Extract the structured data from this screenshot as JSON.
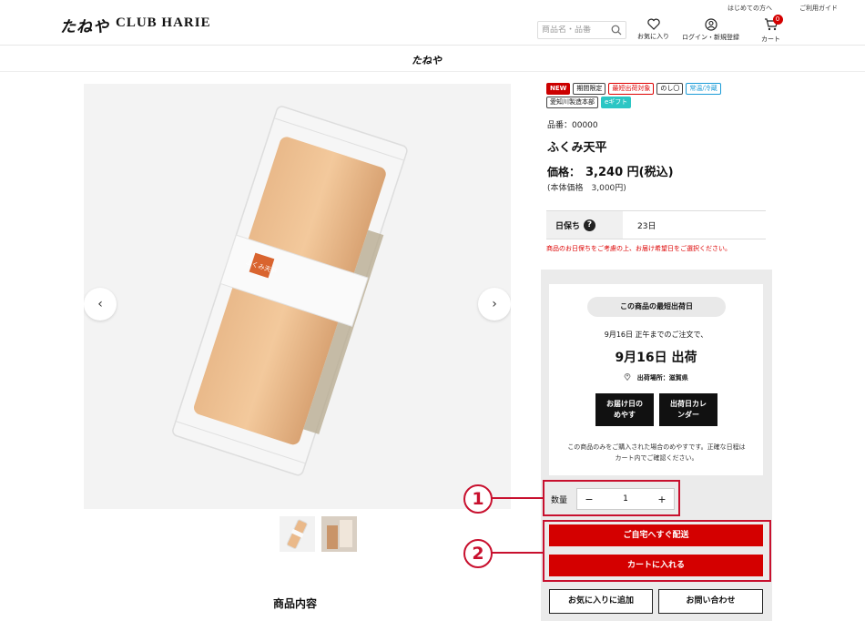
{
  "header": {
    "logo_main": "たねや",
    "logo_club": "CLUB HARIE",
    "links": [
      "はじめての方へ",
      "ご利用ガイド"
    ],
    "search_placeholder": "商品名・品番",
    "favorites_label": "お気に入り",
    "login_label": "ログイン・新規登録",
    "cart_label": "カート",
    "cart_count": "0",
    "sub_logo": "たねや"
  },
  "product": {
    "badges": [
      {
        "text": "NEW",
        "style": "new"
      },
      {
        "text": "期間限定",
        "style": "plain"
      },
      {
        "text": "最短出荷対象",
        "style": "red"
      },
      {
        "text": "のし〇",
        "style": "plain"
      },
      {
        "text": "常温/冷蔵",
        "style": "blue"
      },
      {
        "text": "愛知川製造本部",
        "style": "plain"
      },
      {
        "text": "eギフト",
        "style": "teal"
      }
    ],
    "sku": "品番：00000",
    "name": "ふくみ天平",
    "price_label": "価格：",
    "price_value": "3,240 円(税込)",
    "base_price": "(本体価格　3,000円)",
    "shelf_label": "日保ち",
    "shelf_value": "23日",
    "shelf_note": "商品のお日保ちをご考慮の上、お届け希望日をご選択ください。"
  },
  "shipping": {
    "pill": "この商品の最短出荷日",
    "order_line": "9月16日 正午までのご注文で、",
    "ship_date": "9月16日 出荷",
    "location": "出荷場所：滋賀県",
    "btn_delivery": "お届け日の\nめやす",
    "btn_calendar": "出荷日カレ\nンダー",
    "note": "この商品のみをご購入された場合のめやすです。正確な日程はカート内でご確認ください。"
  },
  "purchase": {
    "qty_label": "数量",
    "qty_value": "1",
    "minus": "−",
    "plus": "+",
    "home_delivery": "ご自宅へすぐ配送",
    "add_to_cart": "カートに入れる",
    "add_favorite": "お気に入りに追加",
    "inquiry": "お問い合わせ"
  },
  "gallery": {
    "prev": "‹",
    "next": "›",
    "seal_text": "ふくみ天平"
  },
  "section_title": "商品内容",
  "callouts": [
    "1",
    "2"
  ],
  "colors": {
    "accent": "#d40000",
    "callout": "#c8102e"
  }
}
